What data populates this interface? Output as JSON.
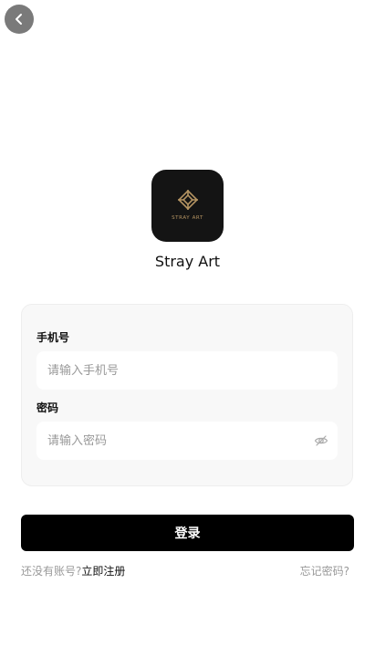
{
  "app": {
    "name": "Stray Art",
    "logo_text": "STRAY ART"
  },
  "nav": {
    "back_icon": "chevron-left-icon"
  },
  "form": {
    "phone": {
      "label": "手机号",
      "placeholder": "请输入手机号",
      "value": ""
    },
    "password": {
      "label": "密码",
      "placeholder": "请输入密码",
      "value": "",
      "toggle_icon": "eye-hidden-icon"
    }
  },
  "actions": {
    "login_label": "登录",
    "no_account_text": "还没有账号?",
    "register_label": "立即注册",
    "forgot_label": "忘记密码?"
  },
  "colors": {
    "primary": "#000000",
    "logo_gold": "#b59462",
    "muted_text": "#999999",
    "card_bg": "#f8f8f8"
  }
}
